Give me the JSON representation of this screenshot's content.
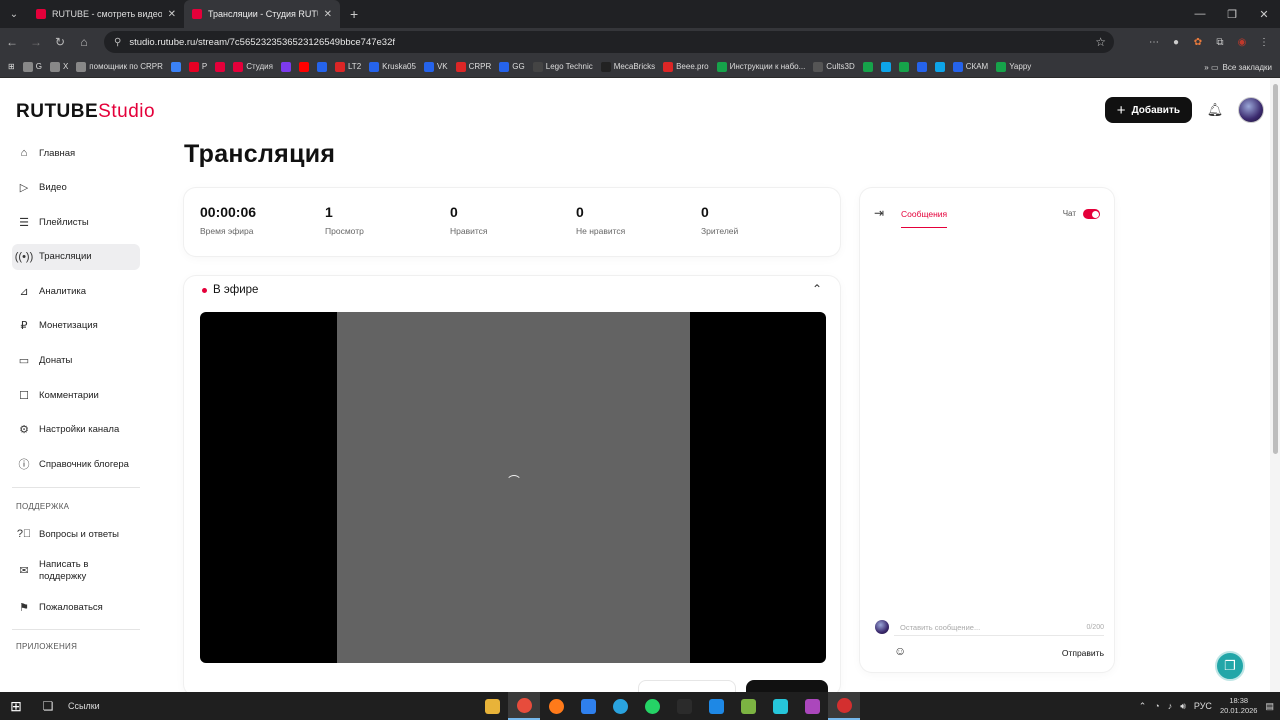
{
  "browser": {
    "tabs": [
      {
        "title": "RUTUBE - смотреть видео он...",
        "favicon_color": "#e4003a"
      },
      {
        "title": "Трансляции - Студия RUTUBE",
        "favicon_color": "#e4003a"
      }
    ],
    "url": "studio.rutube.ru/stream/7c5652323536523126549bbce747e32f",
    "bookmarks": [
      {
        "label": "G",
        "color": "#888"
      },
      {
        "label": "X",
        "color": "#888"
      },
      {
        "label": "помощник по CRPR",
        "color": "#888"
      },
      {
        "label": "",
        "color": "#3b82f6"
      },
      {
        "label": "P",
        "color": "#e60023"
      },
      {
        "label": "",
        "color": "#e4003a"
      },
      {
        "label": "Студия",
        "color": "#e4003a"
      },
      {
        "label": "",
        "color": "#7c3aed"
      },
      {
        "label": "",
        "color": "#ff0000"
      },
      {
        "label": "",
        "color": "#2563eb"
      },
      {
        "label": "LT2",
        "color": "#dc2626"
      },
      {
        "label": "Kruska05",
        "color": "#2563eb"
      },
      {
        "label": "VK",
        "color": "#2563eb"
      },
      {
        "label": "CRPR",
        "color": "#dc2626"
      },
      {
        "label": "GG",
        "color": "#2563eb"
      },
      {
        "label": "Lego Technic",
        "color": "#444"
      },
      {
        "label": "MecaBricks",
        "color": "#222"
      },
      {
        "label": "Beee.pro",
        "color": "#dc2626"
      },
      {
        "label": "Инструкции к набо...",
        "color": "#16a34a"
      },
      {
        "label": "Cults3D",
        "color": "#555"
      },
      {
        "label": "",
        "color": "#16a34a"
      },
      {
        "label": "",
        "color": "#0ea5e9"
      },
      {
        "label": "",
        "color": "#16a34a"
      },
      {
        "label": "",
        "color": "#2563eb"
      },
      {
        "label": "",
        "color": "#0ea5e9"
      },
      {
        "label": "СКАМ",
        "color": "#2563eb"
      },
      {
        "label": "Yappy",
        "color": "#16a34a"
      }
    ],
    "all_bookmarks": "Все закладки"
  },
  "header": {
    "logo_main": "RUTUBE",
    "logo_studio": "Studio",
    "add_button": "Добавить"
  },
  "sidebar": {
    "items": [
      {
        "label": "Главная",
        "icon": "home-icon"
      },
      {
        "label": "Видео",
        "icon": "video-icon"
      },
      {
        "label": "Плейлисты",
        "icon": "playlist-icon"
      },
      {
        "label": "Трансляции",
        "icon": "broadcast-icon"
      },
      {
        "label": "Аналитика",
        "icon": "analytics-icon"
      },
      {
        "label": "Монетизация",
        "icon": "monetization-icon"
      },
      {
        "label": "Донаты",
        "icon": "donate-icon"
      },
      {
        "label": "Комментарии",
        "icon": "comments-icon"
      },
      {
        "label": "Настройки канала",
        "icon": "settings-icon"
      },
      {
        "label": "Справочник блогера",
        "icon": "info-icon"
      }
    ],
    "support_section": "ПОДДЕРЖКА",
    "support_items": [
      {
        "label": "Вопросы и ответы"
      },
      {
        "label": "Написать в поддержку"
      },
      {
        "label": "Пожаловаться"
      }
    ],
    "apps_section": "ПРИЛОЖЕНИЯ"
  },
  "main": {
    "title": "Трансляция",
    "stats": [
      {
        "value": "00:00:06",
        "label": "Время эфира"
      },
      {
        "value": "1",
        "label": "Просмотр"
      },
      {
        "value": "0",
        "label": "Нравится"
      },
      {
        "value": "0",
        "label": "Не нравится"
      },
      {
        "value": "0",
        "label": "Зрителей"
      }
    ],
    "live_label": "В эфире"
  },
  "chat": {
    "tab_messages": "Сообщения",
    "chat_label": "Чат",
    "chat_enabled": true,
    "placeholder": "Оставить сообщение...",
    "counter": "0/200",
    "send": "Отправить"
  },
  "taskbar": {
    "links_label": "Ссылки",
    "lang": "РУС",
    "time": "18:38",
    "date": "20.01.2026"
  },
  "colors": {
    "brand_red": "#e4003a",
    "support_fab": "#22a6a8"
  }
}
